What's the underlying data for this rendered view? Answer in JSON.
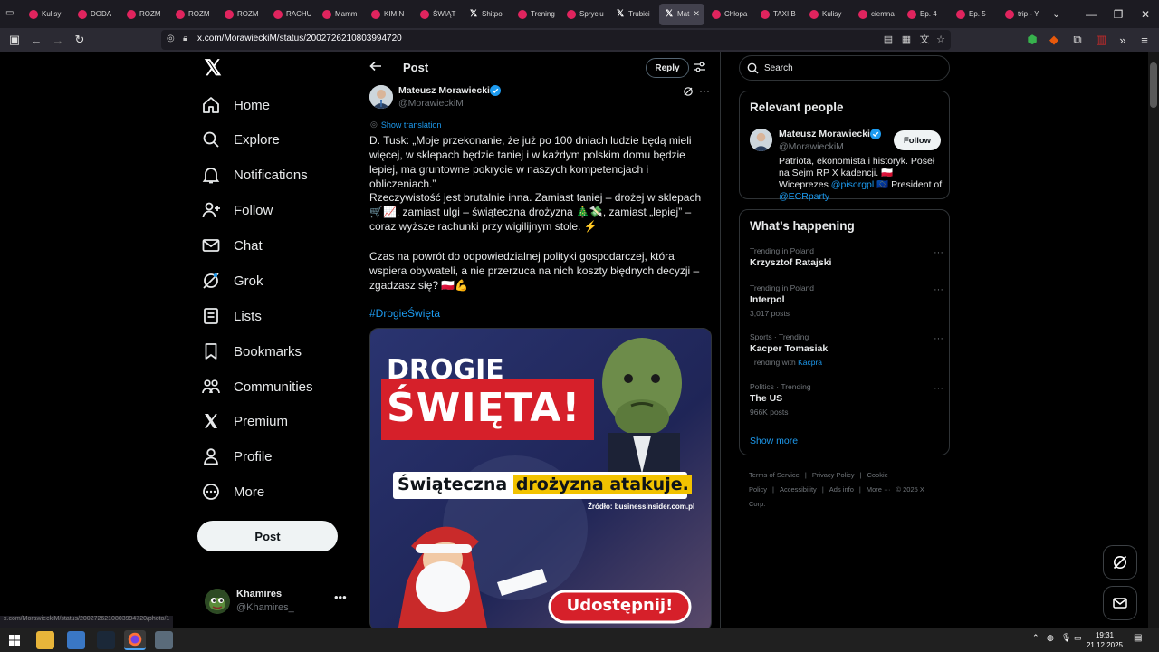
{
  "browser": {
    "tabs": [
      {
        "label": "Kulisy"
      },
      {
        "label": "DODA"
      },
      {
        "label": "ROZM"
      },
      {
        "label": "ROZM"
      },
      {
        "label": "ROZM"
      },
      {
        "label": "RACHU"
      },
      {
        "label": "Mamm"
      },
      {
        "label": "KIM N"
      },
      {
        "label": "ŚWIĄT"
      },
      {
        "label": "Shitpo"
      },
      {
        "label": "Trening"
      },
      {
        "label": "Spryciu"
      },
      {
        "label": "Trubici"
      },
      {
        "label": "Mat"
      },
      {
        "label": "Chłopa"
      },
      {
        "label": "TAXI B"
      },
      {
        "label": "Kulisy"
      },
      {
        "label": "ciemna"
      },
      {
        "label": "Ep. 4"
      },
      {
        "label": "Ep. 5"
      },
      {
        "label": "trip - Y"
      }
    ],
    "url": "x.com/MorawieckiM/status/2002726210803994720",
    "status_url": "x.com/MorawieckiM/status/2002726210803994720/photo/1"
  },
  "nav": {
    "items": [
      {
        "label": "Home",
        "icon": "home-icon"
      },
      {
        "label": "Explore",
        "icon": "search-icon"
      },
      {
        "label": "Notifications",
        "icon": "bell-icon"
      },
      {
        "label": "Follow",
        "icon": "person-plus-icon"
      },
      {
        "label": "Chat",
        "icon": "envelope-icon"
      },
      {
        "label": "Grok",
        "icon": "grok-icon"
      },
      {
        "label": "Lists",
        "icon": "list-icon"
      },
      {
        "label": "Bookmarks",
        "icon": "bookmark-icon"
      },
      {
        "label": "Communities",
        "icon": "communities-icon"
      },
      {
        "label": "Premium",
        "icon": "x-logo-icon"
      },
      {
        "label": "Profile",
        "icon": "person-icon"
      },
      {
        "label": "More",
        "icon": "more-circle-icon"
      }
    ],
    "post_button": "Post",
    "account": {
      "name": "Khamires",
      "handle": "@Khamires_"
    }
  },
  "main": {
    "header_title": "Post",
    "reply_button": "Reply",
    "author": {
      "name": "Mateusz Morawiecki",
      "handle": "@MorawieckiM"
    },
    "show_translation": "Show translation",
    "paragraphs": [
      "D. Tusk: „Moje przekonanie, że już po 100 dniach ludzie będą mieli więcej, w sklepach będzie taniej i w każdym polskim domu będzie lepiej, ma gruntowne pokrycie w naszych kompetencjach i obliczeniach.”",
      "Rzeczywistość jest brutalnie inna. Zamiast taniej – drożej w sklepach 🛒📈, zamiast ulgi – świąteczna drożyzna 🎄💸, zamiast „lepiej” – coraz wyższe rachunki przy wigilijnym stole. ⚡",
      "Czas na powrót do odpowiedzialnej polityki gospodarczej, która wspiera obywateli, a nie przerzuca na nich koszty błędnych decyzji – zgadzasz się? 🇵🇱💪"
    ],
    "hashtag": "#DrogieŚwięta",
    "image": {
      "headline_1": "DROGIE",
      "headline_2": "ŚWIĘTA!",
      "banner_a": "Świąteczna ",
      "banner_b": "drożyzna atakuje.",
      "source": "Źródło: businessinsider.com.pl",
      "cta": "Udostępnij!"
    }
  },
  "right": {
    "search_placeholder": "Search",
    "relevant_title": "Relevant people",
    "relevant_person": {
      "name": "Mateusz Morawiecki",
      "handle": "@MorawieckiM",
      "follow": "Follow",
      "bio_1": "Patriota, ekonomista i historyk. Poseł na Sejm RP X kadencji. 🇵🇱 Wiceprezes",
      "bio_link_1": "@pisorgpl",
      "bio_2": " 🇪🇺 President of ",
      "bio_link_2": "@ECRparty"
    },
    "happening_title": "What’s happening",
    "trends": [
      {
        "category": "Trending in Poland",
        "name": "Krzysztof Ratajski",
        "meta": ""
      },
      {
        "category": "Trending in Poland",
        "name": "Interpol",
        "meta": "3,017 posts"
      },
      {
        "category": "Sports · Trending",
        "name": "Kacper Tomasiak",
        "meta": "Trending with ",
        "meta_link": "Kacpra"
      },
      {
        "category": "Politics · Trending",
        "name": "The US",
        "meta": "966K posts"
      }
    ],
    "show_more": "Show more",
    "footer": [
      "Terms of Service",
      "|",
      "Privacy Policy",
      "|",
      "Cookie Policy",
      "|",
      "Accessibility",
      "|",
      "Ads info",
      "|",
      "More ···",
      "© 2025 X Corp."
    ]
  },
  "taskbar": {
    "time": "19:31",
    "date": "21.12.2025"
  },
  "colors": {
    "accent": "#1d9bf0",
    "background": "#000000",
    "text": "#e7e9ea",
    "muted": "#71767b",
    "border": "#2f3336"
  }
}
